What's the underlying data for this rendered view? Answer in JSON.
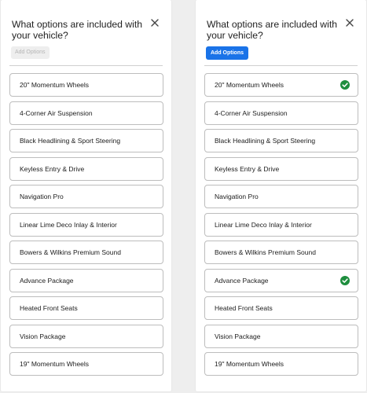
{
  "left_panel": {
    "title": "What options are included with your vehicle?",
    "add_button_label": "Add Options",
    "add_button_state": "disabled",
    "options": [
      {
        "label": "20\" Momentum Wheels",
        "selected": false
      },
      {
        "label": "4-Corner Air Suspension",
        "selected": false
      },
      {
        "label": "Black Headlining & Sport Steering",
        "selected": false
      },
      {
        "label": "Keyless Entry & Drive",
        "selected": false
      },
      {
        "label": "Navigation Pro",
        "selected": false
      },
      {
        "label": "Linear Lime Deco Inlay & Interior",
        "selected": false
      },
      {
        "label": "Bowers & Wilkins Premium Sound",
        "selected": false
      },
      {
        "label": "Advance Package",
        "selected": false
      },
      {
        "label": "Heated Front Seats",
        "selected": false
      },
      {
        "label": "Vision Package",
        "selected": false
      },
      {
        "label": "19\" Momentum Wheels",
        "selected": false
      }
    ]
  },
  "right_panel": {
    "title": "What options are included with your vehicle?",
    "add_button_label": "Add Options",
    "add_button_state": "enabled",
    "options": [
      {
        "label": "20\" Momentum Wheels",
        "selected": true
      },
      {
        "label": "4-Corner Air Suspension",
        "selected": false
      },
      {
        "label": "Black Headlining & Sport Steering",
        "selected": false
      },
      {
        "label": "Keyless Entry & Drive",
        "selected": false
      },
      {
        "label": "Navigation Pro",
        "selected": false
      },
      {
        "label": "Linear Lime Deco Inlay & Interior",
        "selected": false
      },
      {
        "label": "Bowers & Wilkins Premium Sound",
        "selected": false
      },
      {
        "label": "Advance Package",
        "selected": true
      },
      {
        "label": "Heated Front Seats",
        "selected": false
      },
      {
        "label": "Vision Package",
        "selected": false
      },
      {
        "label": "19\" Momentum Wheels",
        "selected": false
      }
    ]
  },
  "icons": {
    "close": "close-icon",
    "check": "check-circle-icon"
  },
  "colors": {
    "accent": "#1a73e8",
    "check": "#1e8e3e",
    "disabled_bg": "#eeeeee",
    "disabled_text": "#b5b5b5"
  }
}
